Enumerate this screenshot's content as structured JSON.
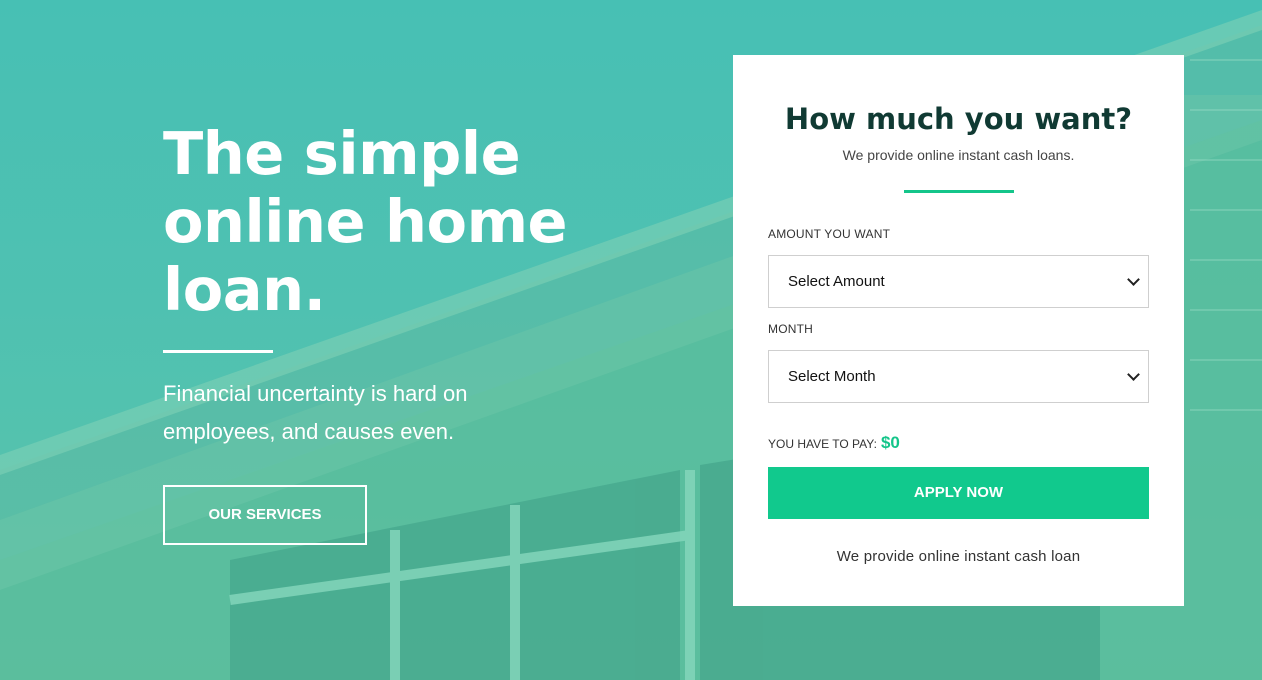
{
  "hero": {
    "title_line1": "The simple",
    "title_line2": "online home",
    "title_line3": "loan.",
    "subtitle": "Financial uncertainty is hard on employees, and causes even.",
    "services_button": "OUR SERVICES"
  },
  "form": {
    "title": "How much you want?",
    "subtitle": "We provide online instant cash loans.",
    "amount_label": "AMOUNT YOU WANT",
    "amount_value": "Select Amount",
    "month_label": "MONTH",
    "month_value": "Select Month",
    "pay_label": "YOU HAVE TO PAY:",
    "pay_value": "$0",
    "apply_button": "APPLY NOW",
    "footer_text": "We provide online instant cash loan"
  },
  "colors": {
    "accent": "#11c98d",
    "hero_overlay": "#47c0b4",
    "card_title": "#103a33"
  },
  "icons": {
    "select_arrow": "chevron-down-icon"
  }
}
